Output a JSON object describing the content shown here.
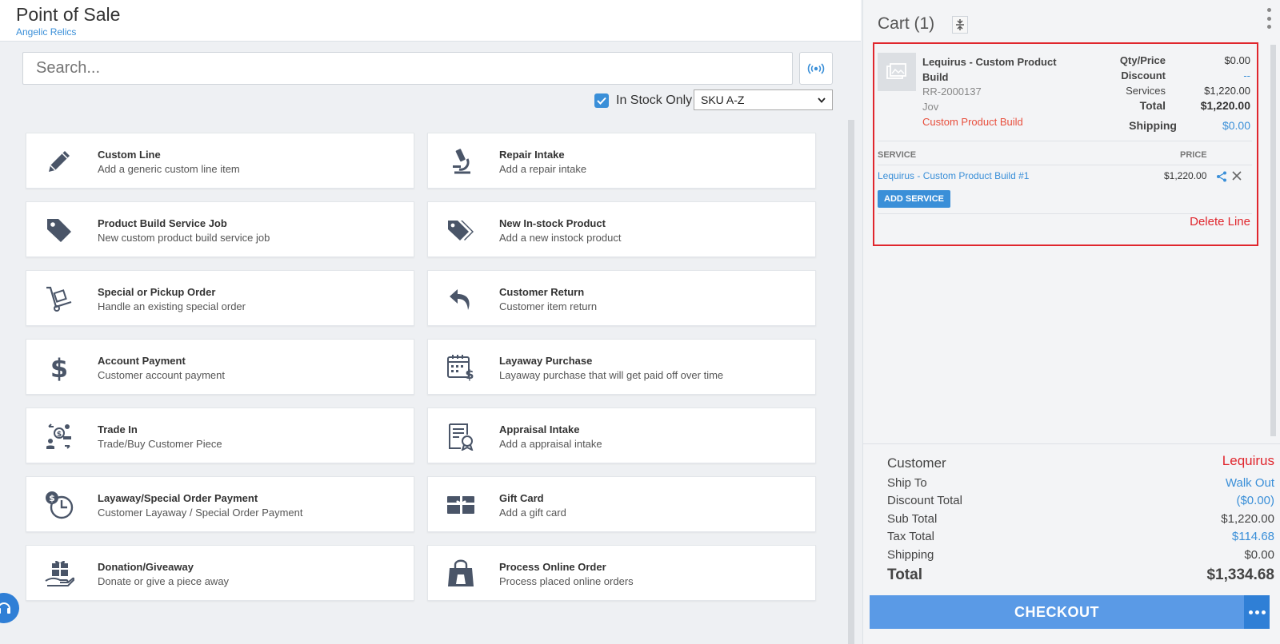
{
  "header": {
    "title": "Point of Sale",
    "store": "Angelic Relics"
  },
  "search": {
    "placeholder": "Search..."
  },
  "filters": {
    "in_stock_label": "In Stock Only",
    "in_stock_checked": true,
    "sort_value": "SKU A-Z"
  },
  "tiles": [
    {
      "title": "Custom Line",
      "desc": "Add a generic custom line item",
      "icon": "pencil-icon"
    },
    {
      "title": "Repair Intake",
      "desc": "Add a repair intake",
      "icon": "microscope-icon"
    },
    {
      "title": "Product Build Service Job",
      "desc": "New custom product build service job",
      "icon": "tag-icon"
    },
    {
      "title": "New In-stock Product",
      "desc": "Add a new instock product",
      "icon": "tags-icon"
    },
    {
      "title": "Special or Pickup Order",
      "desc": "Handle an existing special order",
      "icon": "dolly-icon"
    },
    {
      "title": "Customer Return",
      "desc": "Customer item return",
      "icon": "return-arrow-icon"
    },
    {
      "title": "Account Payment",
      "desc": "Customer account payment",
      "icon": "dollar-icon"
    },
    {
      "title": "Layaway Purchase",
      "desc": "Layaway purchase that will get paid off over time",
      "icon": "calendar-dollar-icon"
    },
    {
      "title": "Trade In",
      "desc": "Trade/Buy Customer Piece",
      "icon": "trade-in-icon"
    },
    {
      "title": "Appraisal Intake",
      "desc": "Add a appraisal intake",
      "icon": "certificate-icon"
    },
    {
      "title": "Layaway/Special Order Payment",
      "desc": "Customer Layaway / Special Order Payment",
      "icon": "clock-dollar-icon"
    },
    {
      "title": "Gift Card",
      "desc": "Add a gift card",
      "icon": "gift-card-icon"
    },
    {
      "title": "Donation/Giveaway",
      "desc": "Donate or give a piece away",
      "icon": "gift-hand-icon"
    },
    {
      "title": "Process Online Order",
      "desc": "Process placed online orders",
      "icon": "shopping-bag-icon"
    }
  ],
  "cart": {
    "title": "Cart (1)",
    "line": {
      "name": "Lequirus - Custom Product Build",
      "sku": "RR-2000137",
      "employee": "Jov",
      "type": "Custom Product Build",
      "qty_price_label": "Qty/Price",
      "qty_price_value": "$0.00",
      "discount_label": "Discount",
      "discount_value": "--",
      "services_label": "Services",
      "services_value": "$1,220.00",
      "total_label": "Total",
      "total_value": "$1,220.00",
      "shipping_label": "Shipping",
      "shipping_value": "$0.00",
      "service_header": "SERVICE",
      "price_header": "PRICE",
      "service_name": "Lequirus - Custom Product Build #1",
      "service_price": "$1,220.00",
      "add_service": "ADD SERVICE",
      "delete_line": "Delete Line"
    },
    "summary": {
      "customer_label": "Customer",
      "customer_value": "Lequirus",
      "ship_to_label": "Ship To",
      "ship_to_value": "Walk Out",
      "discount_total_label": "Discount Total",
      "discount_total_value": "($0.00)",
      "sub_total_label": "Sub Total",
      "sub_total_value": "$1,220.00",
      "tax_total_label": "Tax Total",
      "tax_total_value": "$114.68",
      "shipping_label": "Shipping",
      "shipping_value": "$0.00",
      "total_label": "Total",
      "total_value": "$1,334.68"
    },
    "checkout": "CHECKOUT"
  },
  "colors": {
    "accent": "#3a8fd8",
    "danger": "#e0262d",
    "checkout": "#5a9ae6",
    "icon": "#4a5568"
  }
}
